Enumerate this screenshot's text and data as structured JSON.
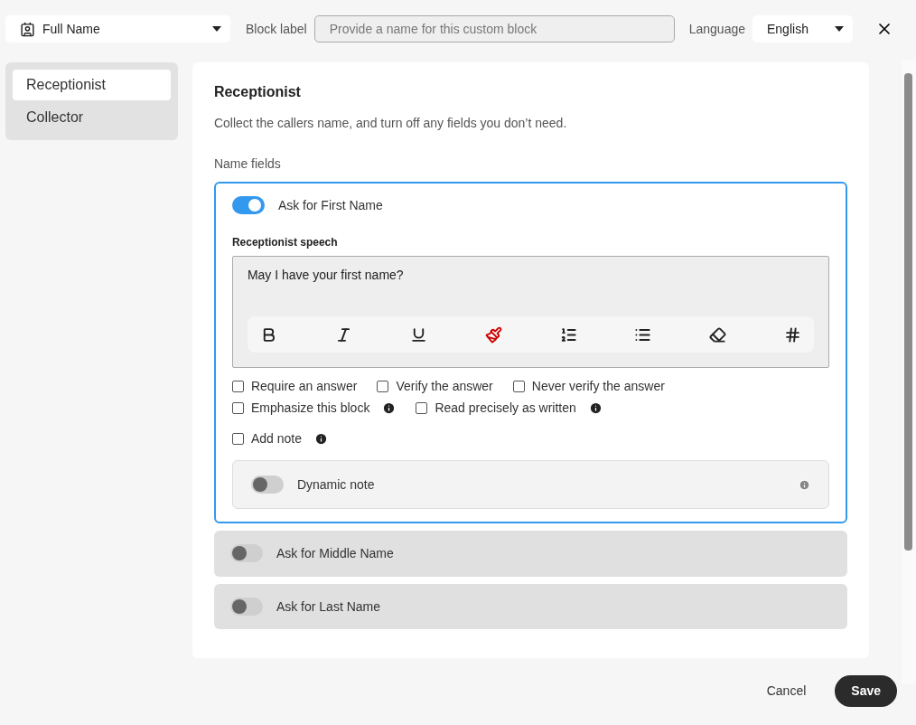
{
  "header": {
    "block_type": "Full Name",
    "block_label": {
      "label": "Block label",
      "placeholder": "Provide a name for this custom block"
    },
    "language": {
      "label": "Language",
      "value": "English"
    }
  },
  "sidebar": {
    "items": [
      {
        "label": "Receptionist",
        "selected": true
      },
      {
        "label": "Collector",
        "selected": false
      }
    ]
  },
  "panel": {
    "title": "Receptionist",
    "description": "Collect the callers name, and turn off any fields you don’t need.",
    "section_label": "Name fields",
    "fields": [
      {
        "label": "Ask for First Name",
        "on": true,
        "expanded": true,
        "speech_label": "Receptionist speech",
        "speech": "May I have your first name?",
        "toolbar": [
          {
            "kind": "bold"
          },
          {
            "kind": "italic"
          },
          {
            "kind": "underline"
          },
          {
            "kind": "highlight"
          },
          {
            "kind": "ordered"
          },
          {
            "kind": "bullets"
          },
          {
            "kind": "eraser"
          },
          {
            "kind": "hash"
          }
        ],
        "option_rows": [
          [
            {
              "label": "Require an answer",
              "checked": false,
              "info": false
            },
            {
              "label": "Verify the answer",
              "checked": false,
              "info": false
            },
            {
              "label": "Never verify the answer",
              "checked": false,
              "info": false
            }
          ],
          [
            {
              "label": "Emphasize this block",
              "checked": false,
              "info": true
            },
            {
              "label": "Read precisely as written",
              "checked": false,
              "info": true
            }
          ],
          [
            {
              "label": "Add note",
              "checked": false,
              "info": true
            }
          ]
        ],
        "dynamic_note": {
          "label": "Dynamic note",
          "on": false
        }
      },
      {
        "label": "Ask for Middle Name",
        "on": false,
        "expanded": false
      },
      {
        "label": "Ask for Last Name",
        "on": false,
        "expanded": false
      }
    ]
  },
  "footer": {
    "buttons": [
      {
        "label": "Cancel",
        "kind": "text"
      },
      {
        "label": "Save",
        "kind": "primary"
      }
    ]
  }
}
